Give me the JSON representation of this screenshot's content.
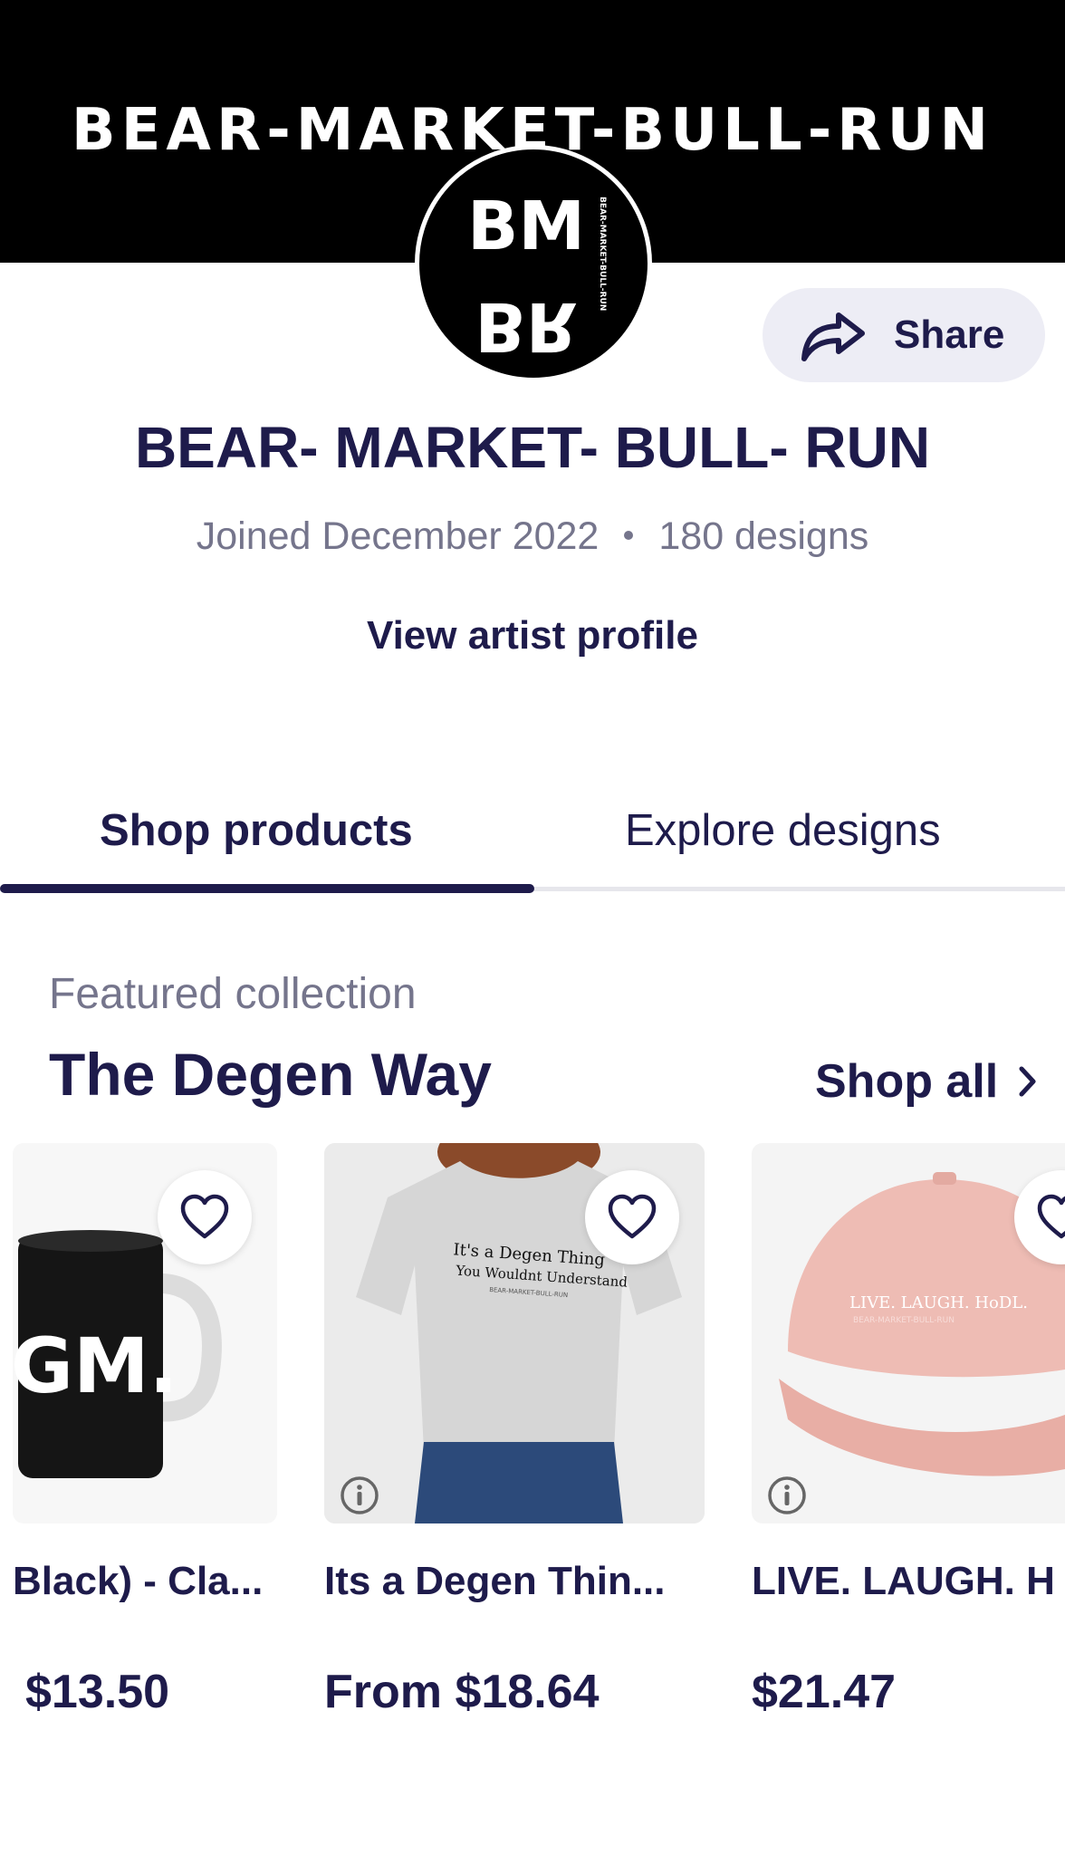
{
  "banner": {
    "title": "BEAR-MARKET-BULL-RUN"
  },
  "avatar": {
    "monogram_top": "BM",
    "monogram_bottom": "BR",
    "side_text": "BEAR-MARKET-BULL-RUN"
  },
  "share": {
    "label": "Share",
    "icon": "share-icon"
  },
  "shop": {
    "name": "BEAR- MARKET- BULL- RUN",
    "joined": "Joined December 2022",
    "designs": "180 designs",
    "view_profile": "View artist profile"
  },
  "tabs": [
    {
      "label": "Shop products",
      "active": true
    },
    {
      "label": "Explore designs",
      "active": false
    }
  ],
  "collection": {
    "featured_label": "Featured collection",
    "title": "The Degen Way",
    "shop_all": "Shop all"
  },
  "products": [
    {
      "title": "Black) - Cla...",
      "price": "$13.50",
      "image_text": "GM."
    },
    {
      "title": "Its a Degen Thin...",
      "price": "From $18.64",
      "image_text_1": "It's a Degen Thing",
      "image_text_2": "You Wouldnt Understand",
      "image_text_3": "BEAR-MARKET-BULL-RUN"
    },
    {
      "title": "LIVE. LAUGH. H",
      "price": "$21.47",
      "image_text_1": "LIVE. LAUGH. HoDL.",
      "image_text_2": "BEAR-MARKET-BULL-RUN"
    }
  ],
  "colors": {
    "primary": "#1e1b4b",
    "muted": "#75758c",
    "banner": "#000000",
    "share_bg": "#ededf5",
    "cap": "#eebcb4"
  }
}
